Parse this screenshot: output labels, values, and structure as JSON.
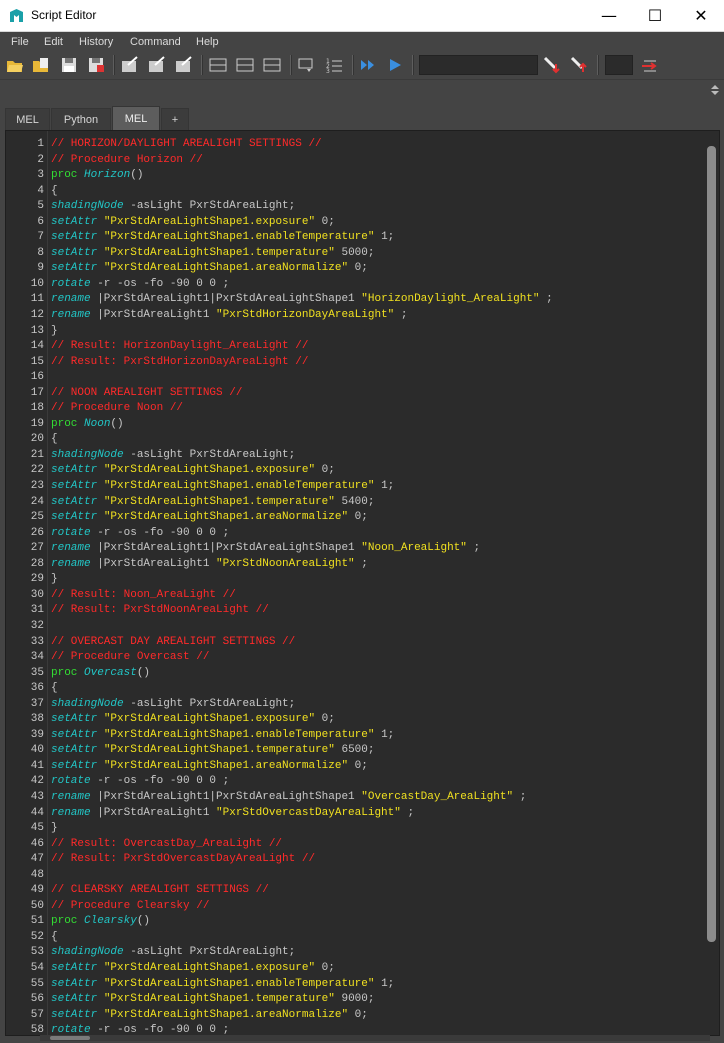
{
  "window": {
    "title": "Script Editor",
    "minimize_glyph": "—",
    "maximize_glyph": "☐",
    "close_glyph": "✕"
  },
  "menu": [
    "File",
    "Edit",
    "History",
    "Command",
    "Help"
  ],
  "tabs": [
    {
      "label": "MEL",
      "active": false
    },
    {
      "label": "Python",
      "active": false
    },
    {
      "label": "MEL",
      "active": true
    },
    {
      "label": "+",
      "active": false
    }
  ],
  "colors": {
    "comment": "#ff2a2a",
    "keyword": "#33dd33",
    "command": "#22c6c6",
    "string": "#f0e020",
    "plain": "#c8c8c8",
    "background": "#2b2b2b"
  },
  "code_lines": [
    {
      "n": "1",
      "tokens": [
        [
          "comment",
          "// HORIZON/DAYLIGHT AREALIGHT SETTINGS //"
        ]
      ]
    },
    {
      "n": "2",
      "tokens": [
        [
          "comment",
          "// Procedure Horizon //"
        ]
      ]
    },
    {
      "n": "3",
      "tokens": [
        [
          "kw",
          "proc"
        ],
        [
          "plain",
          " "
        ],
        [
          "proc",
          "Horizon"
        ],
        [
          "plain",
          "()"
        ]
      ]
    },
    {
      "n": "4",
      "tokens": [
        [
          "plain",
          "{"
        ]
      ]
    },
    {
      "n": "5",
      "tokens": [
        [
          "cmd",
          "shadingNode"
        ],
        [
          "plain",
          " -asLight PxrStdAreaLight;"
        ]
      ]
    },
    {
      "n": "6",
      "tokens": [
        [
          "cmd",
          "setAttr"
        ],
        [
          "plain",
          " "
        ],
        [
          "str",
          "\"PxrStdAreaLightShape1.exposure\""
        ],
        [
          "plain",
          " 0;"
        ]
      ]
    },
    {
      "n": "7",
      "tokens": [
        [
          "cmd",
          "setAttr"
        ],
        [
          "plain",
          " "
        ],
        [
          "str",
          "\"PxrStdAreaLightShape1.enableTemperature\""
        ],
        [
          "plain",
          " 1;"
        ]
      ]
    },
    {
      "n": "8",
      "tokens": [
        [
          "cmd",
          "setAttr"
        ],
        [
          "plain",
          " "
        ],
        [
          "str",
          "\"PxrStdAreaLightShape1.temperature\""
        ],
        [
          "plain",
          " 5000;"
        ]
      ]
    },
    {
      "n": "9",
      "tokens": [
        [
          "cmd",
          "setAttr"
        ],
        [
          "plain",
          " "
        ],
        [
          "str",
          "\"PxrStdAreaLightShape1.areaNormalize\""
        ],
        [
          "plain",
          " 0;"
        ]
      ]
    },
    {
      "n": "10",
      "tokens": [
        [
          "cmd",
          "rotate"
        ],
        [
          "plain",
          " -r -os -fo -90 0 0 ;"
        ]
      ]
    },
    {
      "n": "11",
      "tokens": [
        [
          "cmd",
          "rename"
        ],
        [
          "plain",
          " |PxrStdAreaLight1|PxrStdAreaLightShape1 "
        ],
        [
          "str",
          "\"HorizonDaylight_AreaLight\""
        ],
        [
          "plain",
          " ;"
        ]
      ]
    },
    {
      "n": "12",
      "tokens": [
        [
          "cmd",
          "rename"
        ],
        [
          "plain",
          " |PxrStdAreaLight1 "
        ],
        [
          "str",
          "\"PxrStdHorizonDayAreaLight\""
        ],
        [
          "plain",
          " ;"
        ]
      ]
    },
    {
      "n": "13",
      "tokens": [
        [
          "plain",
          "}"
        ]
      ]
    },
    {
      "n": "14",
      "tokens": [
        [
          "comment",
          "// Result: HorizonDaylight_AreaLight //"
        ]
      ]
    },
    {
      "n": "15",
      "tokens": [
        [
          "comment",
          "// Result: PxrStdHorizonDayAreaLight //"
        ]
      ]
    },
    {
      "n": "16",
      "tokens": []
    },
    {
      "n": "17",
      "tokens": [
        [
          "comment",
          "// NOON AREALIGHT SETTINGS //"
        ]
      ]
    },
    {
      "n": "18",
      "tokens": [
        [
          "comment",
          "// Procedure Noon //"
        ]
      ]
    },
    {
      "n": "19",
      "tokens": [
        [
          "kw",
          "proc"
        ],
        [
          "plain",
          " "
        ],
        [
          "proc",
          "Noon"
        ],
        [
          "plain",
          "()"
        ]
      ]
    },
    {
      "n": "20",
      "tokens": [
        [
          "plain",
          "{"
        ]
      ]
    },
    {
      "n": "21",
      "tokens": [
        [
          "cmd",
          "shadingNode"
        ],
        [
          "plain",
          " -asLight PxrStdAreaLight;"
        ]
      ]
    },
    {
      "n": "22",
      "tokens": [
        [
          "cmd",
          "setAttr"
        ],
        [
          "plain",
          " "
        ],
        [
          "str",
          "\"PxrStdAreaLightShape1.exposure\""
        ],
        [
          "plain",
          " 0;"
        ]
      ]
    },
    {
      "n": "23",
      "tokens": [
        [
          "cmd",
          "setAttr"
        ],
        [
          "plain",
          " "
        ],
        [
          "str",
          "\"PxrStdAreaLightShape1.enableTemperature\""
        ],
        [
          "plain",
          " 1;"
        ]
      ]
    },
    {
      "n": "24",
      "tokens": [
        [
          "cmd",
          "setAttr"
        ],
        [
          "plain",
          " "
        ],
        [
          "str",
          "\"PxrStdAreaLightShape1.temperature\""
        ],
        [
          "plain",
          " 5400;"
        ]
      ]
    },
    {
      "n": "25",
      "tokens": [
        [
          "cmd",
          "setAttr"
        ],
        [
          "plain",
          " "
        ],
        [
          "str",
          "\"PxrStdAreaLightShape1.areaNormalize\""
        ],
        [
          "plain",
          " 0;"
        ]
      ]
    },
    {
      "n": "26",
      "tokens": [
        [
          "cmd",
          "rotate"
        ],
        [
          "plain",
          " -r -os -fo -90 0 0 ;"
        ]
      ]
    },
    {
      "n": "27",
      "tokens": [
        [
          "cmd",
          "rename"
        ],
        [
          "plain",
          " |PxrStdAreaLight1|PxrStdAreaLightShape1 "
        ],
        [
          "str",
          "\"Noon_AreaLight\""
        ],
        [
          "plain",
          " ;"
        ]
      ]
    },
    {
      "n": "28",
      "tokens": [
        [
          "cmd",
          "rename"
        ],
        [
          "plain",
          " |PxrStdAreaLight1 "
        ],
        [
          "str",
          "\"PxrStdNoonAreaLight\""
        ],
        [
          "plain",
          " ;"
        ]
      ]
    },
    {
      "n": "29",
      "tokens": [
        [
          "plain",
          "}"
        ]
      ]
    },
    {
      "n": "30",
      "tokens": [
        [
          "comment",
          "// Result: Noon_AreaLight //"
        ]
      ]
    },
    {
      "n": "31",
      "tokens": [
        [
          "comment",
          "// Result: PxrStdNoonAreaLight //"
        ]
      ]
    },
    {
      "n": "32",
      "tokens": []
    },
    {
      "n": "33",
      "tokens": [
        [
          "comment",
          "// OVERCAST DAY AREALIGHT SETTINGS //"
        ]
      ]
    },
    {
      "n": "34",
      "tokens": [
        [
          "comment",
          "// Procedure Overcast //"
        ]
      ]
    },
    {
      "n": "35",
      "tokens": [
        [
          "kw",
          "proc"
        ],
        [
          "plain",
          " "
        ],
        [
          "proc",
          "Overcast"
        ],
        [
          "plain",
          "()"
        ]
      ]
    },
    {
      "n": "36",
      "tokens": [
        [
          "plain",
          "{"
        ]
      ]
    },
    {
      "n": "37",
      "tokens": [
        [
          "cmd",
          "shadingNode"
        ],
        [
          "plain",
          " -asLight PxrStdAreaLight;"
        ]
      ]
    },
    {
      "n": "38",
      "tokens": [
        [
          "cmd",
          "setAttr"
        ],
        [
          "plain",
          " "
        ],
        [
          "str",
          "\"PxrStdAreaLightShape1.exposure\""
        ],
        [
          "plain",
          " 0;"
        ]
      ]
    },
    {
      "n": "39",
      "tokens": [
        [
          "cmd",
          "setAttr"
        ],
        [
          "plain",
          " "
        ],
        [
          "str",
          "\"PxrStdAreaLightShape1.enableTemperature\""
        ],
        [
          "plain",
          " 1;"
        ]
      ]
    },
    {
      "n": "40",
      "tokens": [
        [
          "cmd",
          "setAttr"
        ],
        [
          "plain",
          " "
        ],
        [
          "str",
          "\"PxrStdAreaLightShape1.temperature\""
        ],
        [
          "plain",
          " 6500;"
        ]
      ]
    },
    {
      "n": "41",
      "tokens": [
        [
          "cmd",
          "setAttr"
        ],
        [
          "plain",
          " "
        ],
        [
          "str",
          "\"PxrStdAreaLightShape1.areaNormalize\""
        ],
        [
          "plain",
          " 0;"
        ]
      ]
    },
    {
      "n": "42",
      "tokens": [
        [
          "cmd",
          "rotate"
        ],
        [
          "plain",
          " -r -os -fo -90 0 0 ;"
        ]
      ]
    },
    {
      "n": "43",
      "tokens": [
        [
          "cmd",
          "rename"
        ],
        [
          "plain",
          " |PxrStdAreaLight1|PxrStdAreaLightShape1 "
        ],
        [
          "str",
          "\"OvercastDay_AreaLight\""
        ],
        [
          "plain",
          " ;"
        ]
      ]
    },
    {
      "n": "44",
      "tokens": [
        [
          "cmd",
          "rename"
        ],
        [
          "plain",
          " |PxrStdAreaLight1 "
        ],
        [
          "str",
          "\"PxrStdOvercastDayAreaLight\""
        ],
        [
          "plain",
          " ;"
        ]
      ]
    },
    {
      "n": "45",
      "tokens": [
        [
          "plain",
          "}"
        ]
      ]
    },
    {
      "n": "46",
      "tokens": [
        [
          "comment",
          "// Result: OvercastDay_AreaLight //"
        ]
      ]
    },
    {
      "n": "47",
      "tokens": [
        [
          "comment",
          "// Result: PxrStdOvercastDayAreaLight //"
        ]
      ]
    },
    {
      "n": "48",
      "tokens": []
    },
    {
      "n": "49",
      "tokens": [
        [
          "comment",
          "// CLEARSKY AREALIGHT SETTINGS //"
        ]
      ]
    },
    {
      "n": "50",
      "tokens": [
        [
          "comment",
          "// Procedure Clearsky //"
        ]
      ]
    },
    {
      "n": "51",
      "tokens": [
        [
          "kw",
          "proc"
        ],
        [
          "plain",
          " "
        ],
        [
          "proc",
          "Clearsky"
        ],
        [
          "plain",
          "()"
        ]
      ]
    },
    {
      "n": "52",
      "tokens": [
        [
          "plain",
          "{"
        ]
      ]
    },
    {
      "n": "53",
      "tokens": [
        [
          "cmd",
          "shadingNode"
        ],
        [
          "plain",
          " -asLight PxrStdAreaLight;"
        ]
      ]
    },
    {
      "n": "54",
      "tokens": [
        [
          "cmd",
          "setAttr"
        ],
        [
          "plain",
          " "
        ],
        [
          "str",
          "\"PxrStdAreaLightShape1.exposure\""
        ],
        [
          "plain",
          " 0;"
        ]
      ]
    },
    {
      "n": "55",
      "tokens": [
        [
          "cmd",
          "setAttr"
        ],
        [
          "plain",
          " "
        ],
        [
          "str",
          "\"PxrStdAreaLightShape1.enableTemperature\""
        ],
        [
          "plain",
          " 1;"
        ]
      ]
    },
    {
      "n": "56",
      "tokens": [
        [
          "cmd",
          "setAttr"
        ],
        [
          "plain",
          " "
        ],
        [
          "str",
          "\"PxrStdAreaLightShape1.temperature\""
        ],
        [
          "plain",
          " 9000;"
        ]
      ]
    },
    {
      "n": "57",
      "tokens": [
        [
          "cmd",
          "setAttr"
        ],
        [
          "plain",
          " "
        ],
        [
          "str",
          "\"PxrStdAreaLightShape1.areaNormalize\""
        ],
        [
          "plain",
          " 0;"
        ]
      ]
    },
    {
      "n": "58",
      "tokens": [
        [
          "cmd",
          "rotate"
        ],
        [
          "plain",
          " -r -os -fo -90 0 0 ;"
        ]
      ]
    }
  ]
}
